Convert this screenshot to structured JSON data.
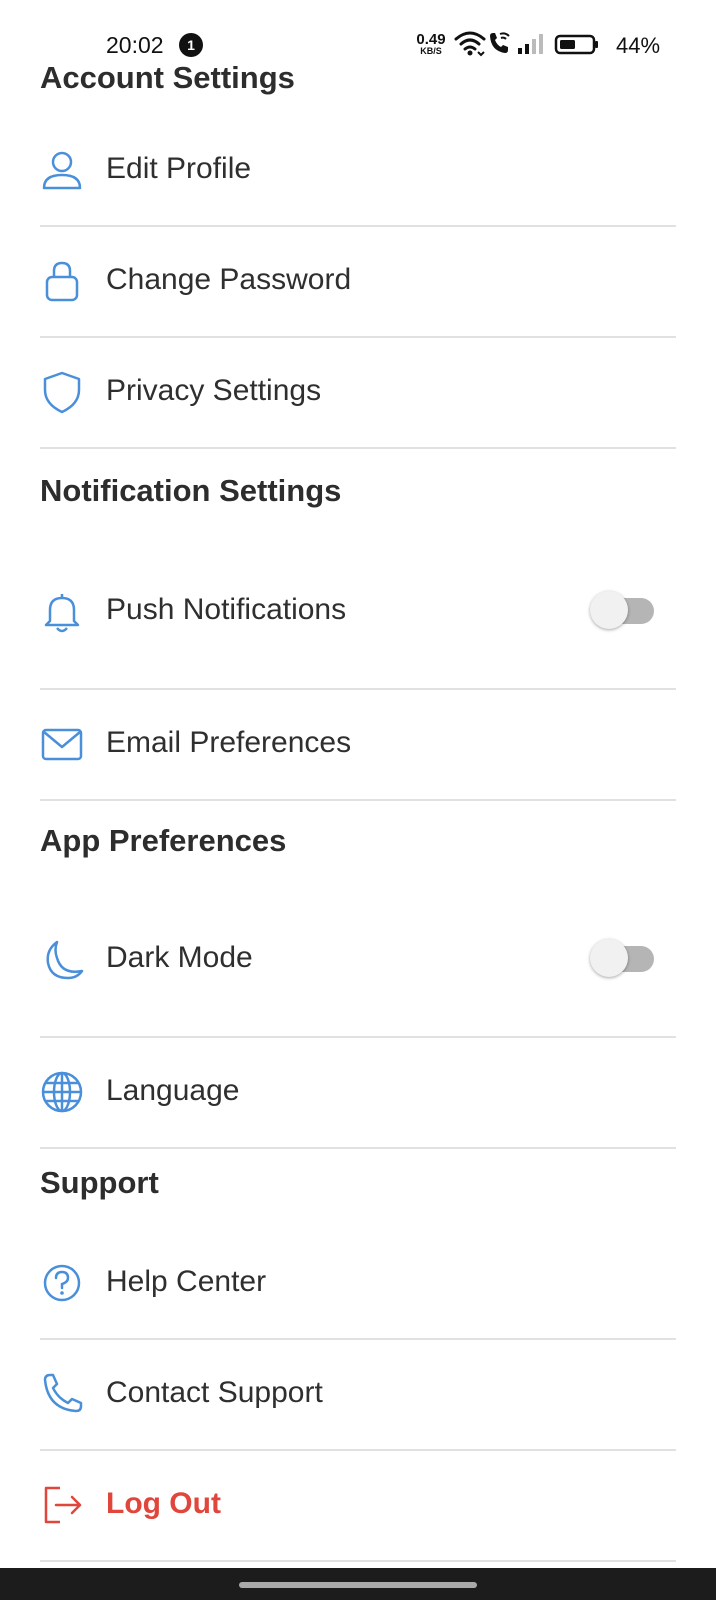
{
  "status_bar": {
    "time": "20:02",
    "notification_count": "1",
    "net_speed": "0.49",
    "net_speed_unit": "KB/S",
    "battery_percent": "44%"
  },
  "theme": {
    "accent": "#4a8fd9",
    "danger": "#e0463b",
    "divider": "#e1e1e1"
  },
  "sections": {
    "account": {
      "title": "Account Settings",
      "items": [
        {
          "label": "Edit Profile",
          "icon": "user-icon"
        },
        {
          "label": "Change Password",
          "icon": "lock-icon"
        },
        {
          "label": "Privacy Settings",
          "icon": "shield-icon"
        }
      ]
    },
    "notifications": {
      "title": "Notification Settings",
      "items": [
        {
          "label": "Push Notifications",
          "icon": "bell-icon",
          "toggle": false
        },
        {
          "label": "Email Preferences",
          "icon": "mail-icon"
        }
      ]
    },
    "app": {
      "title": "App Preferences",
      "items": [
        {
          "label": "Dark Mode",
          "icon": "moon-icon",
          "toggle": false
        },
        {
          "label": "Language",
          "icon": "globe-icon"
        }
      ]
    },
    "support": {
      "title": "Support",
      "items": [
        {
          "label": "Help Center",
          "icon": "help-circle-icon"
        },
        {
          "label": "Contact Support",
          "icon": "phone-icon"
        },
        {
          "label": "Log Out",
          "icon": "logout-icon"
        }
      ]
    }
  }
}
